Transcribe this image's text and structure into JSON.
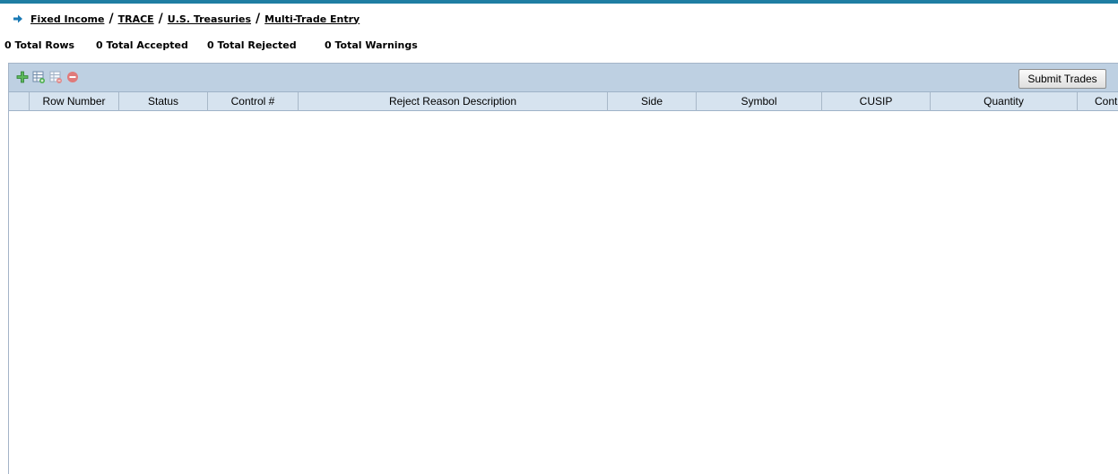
{
  "breadcrumb": {
    "items": [
      "Fixed Income",
      "TRACE",
      "U.S. Treasuries",
      "Multi-Trade Entry"
    ],
    "separator": "/"
  },
  "totals": {
    "rows": "0 Total Rows",
    "accepted": "0 Total Accepted",
    "rejected": "0 Total Rejected",
    "warnings": "0 Total Warnings"
  },
  "toolbar": {
    "icons": [
      "add-icon",
      "add-grid-row-icon",
      "delete-grid-row-icon",
      "remove-icon"
    ],
    "submit_label": "Submit Trades"
  },
  "table": {
    "columns": [
      "Row Number",
      "Status",
      "Control #",
      "Reject Reason Description",
      "Side",
      "Symbol",
      "CUSIP",
      "Quantity",
      "Cont"
    ],
    "rows": []
  },
  "colors": {
    "accent_rule": "#1f7ea3",
    "toolbar_bg": "#bed0e2",
    "header_bg": "#d6e3ef"
  }
}
